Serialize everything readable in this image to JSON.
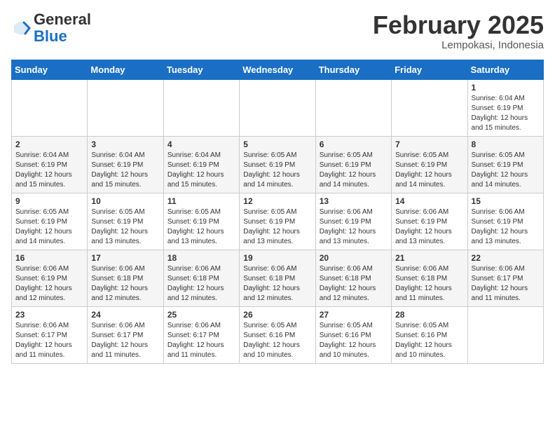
{
  "header": {
    "logo": {
      "general": "General",
      "blue": "Blue"
    },
    "title": "February 2025",
    "location": "Lempokasi, Indonesia"
  },
  "weekdays": [
    "Sunday",
    "Monday",
    "Tuesday",
    "Wednesday",
    "Thursday",
    "Friday",
    "Saturday"
  ],
  "weeks": [
    [
      null,
      null,
      null,
      null,
      null,
      null,
      {
        "day": "1",
        "sunrise": "6:04 AM",
        "sunset": "6:19 PM",
        "daylight": "12 hours and 15 minutes."
      }
    ],
    [
      {
        "day": "2",
        "sunrise": "6:04 AM",
        "sunset": "6:19 PM",
        "daylight": "12 hours and 15 minutes."
      },
      {
        "day": "3",
        "sunrise": "6:04 AM",
        "sunset": "6:19 PM",
        "daylight": "12 hours and 15 minutes."
      },
      {
        "day": "4",
        "sunrise": "6:04 AM",
        "sunset": "6:19 PM",
        "daylight": "12 hours and 15 minutes."
      },
      {
        "day": "5",
        "sunrise": "6:05 AM",
        "sunset": "6:19 PM",
        "daylight": "12 hours and 14 minutes."
      },
      {
        "day": "6",
        "sunrise": "6:05 AM",
        "sunset": "6:19 PM",
        "daylight": "12 hours and 14 minutes."
      },
      {
        "day": "7",
        "sunrise": "6:05 AM",
        "sunset": "6:19 PM",
        "daylight": "12 hours and 14 minutes."
      },
      {
        "day": "8",
        "sunrise": "6:05 AM",
        "sunset": "6:19 PM",
        "daylight": "12 hours and 14 minutes."
      }
    ],
    [
      {
        "day": "9",
        "sunrise": "6:05 AM",
        "sunset": "6:19 PM",
        "daylight": "12 hours and 14 minutes."
      },
      {
        "day": "10",
        "sunrise": "6:05 AM",
        "sunset": "6:19 PM",
        "daylight": "12 hours and 13 minutes."
      },
      {
        "day": "11",
        "sunrise": "6:05 AM",
        "sunset": "6:19 PM",
        "daylight": "12 hours and 13 minutes."
      },
      {
        "day": "12",
        "sunrise": "6:05 AM",
        "sunset": "6:19 PM",
        "daylight": "12 hours and 13 minutes."
      },
      {
        "day": "13",
        "sunrise": "6:06 AM",
        "sunset": "6:19 PM",
        "daylight": "12 hours and 13 minutes."
      },
      {
        "day": "14",
        "sunrise": "6:06 AM",
        "sunset": "6:19 PM",
        "daylight": "12 hours and 13 minutes."
      },
      {
        "day": "15",
        "sunrise": "6:06 AM",
        "sunset": "6:19 PM",
        "daylight": "12 hours and 13 minutes."
      }
    ],
    [
      {
        "day": "16",
        "sunrise": "6:06 AM",
        "sunset": "6:19 PM",
        "daylight": "12 hours and 12 minutes."
      },
      {
        "day": "17",
        "sunrise": "6:06 AM",
        "sunset": "6:18 PM",
        "daylight": "12 hours and 12 minutes."
      },
      {
        "day": "18",
        "sunrise": "6:06 AM",
        "sunset": "6:18 PM",
        "daylight": "12 hours and 12 minutes."
      },
      {
        "day": "19",
        "sunrise": "6:06 AM",
        "sunset": "6:18 PM",
        "daylight": "12 hours and 12 minutes."
      },
      {
        "day": "20",
        "sunrise": "6:06 AM",
        "sunset": "6:18 PM",
        "daylight": "12 hours and 12 minutes."
      },
      {
        "day": "21",
        "sunrise": "6:06 AM",
        "sunset": "6:18 PM",
        "daylight": "12 hours and 11 minutes."
      },
      {
        "day": "22",
        "sunrise": "6:06 AM",
        "sunset": "6:17 PM",
        "daylight": "12 hours and 11 minutes."
      }
    ],
    [
      {
        "day": "23",
        "sunrise": "6:06 AM",
        "sunset": "6:17 PM",
        "daylight": "12 hours and 11 minutes."
      },
      {
        "day": "24",
        "sunrise": "6:06 AM",
        "sunset": "6:17 PM",
        "daylight": "12 hours and 11 minutes."
      },
      {
        "day": "25",
        "sunrise": "6:06 AM",
        "sunset": "6:17 PM",
        "daylight": "12 hours and 11 minutes."
      },
      {
        "day": "26",
        "sunrise": "6:05 AM",
        "sunset": "6:16 PM",
        "daylight": "12 hours and 10 minutes."
      },
      {
        "day": "27",
        "sunrise": "6:05 AM",
        "sunset": "6:16 PM",
        "daylight": "12 hours and 10 minutes."
      },
      {
        "day": "28",
        "sunrise": "6:05 AM",
        "sunset": "6:16 PM",
        "daylight": "12 hours and 10 minutes."
      },
      null
    ]
  ]
}
